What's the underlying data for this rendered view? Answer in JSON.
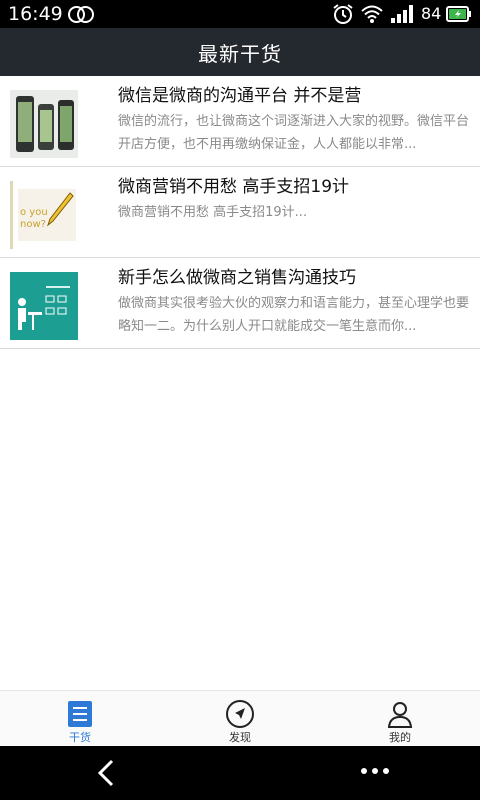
{
  "status_bar": {
    "time": "16:49",
    "battery_level": "84"
  },
  "header": {
    "title": "最新干货"
  },
  "articles": [
    {
      "title": "微信是微商的沟通平台 并不是营",
      "description": "微信的流行，也让微商这个词逐渐进入大家的视野。微信平台开店方便，也不用再缴纳保证金，人人都能以非常..."
    },
    {
      "title": "微商营销不用愁 高手支招19计",
      "description": "微商营销不用愁 高手支招19计..."
    },
    {
      "title": "新手怎么做微商之销售沟通技巧",
      "description": "做微商其实很考验大伙的观察力和语言能力，甚至心理学也要略知一二。为什么别人开口就能成交一笔生意而你..."
    }
  ],
  "thumbnails": [
    {
      "icon": "phones-image"
    },
    {
      "icon": "do-you-know-pen-image",
      "text": "o you\nnow?"
    },
    {
      "icon": "office-worker-illustration"
    }
  ],
  "tabs": [
    {
      "label": "干货",
      "icon": "list-icon",
      "active": true
    },
    {
      "label": "发现",
      "icon": "compass-icon",
      "active": false
    },
    {
      "label": "我的",
      "icon": "user-icon",
      "active": false
    }
  ],
  "colors": {
    "header_bg": "#24282f",
    "accent": "#2f79d6",
    "status_bg": "#000000"
  }
}
